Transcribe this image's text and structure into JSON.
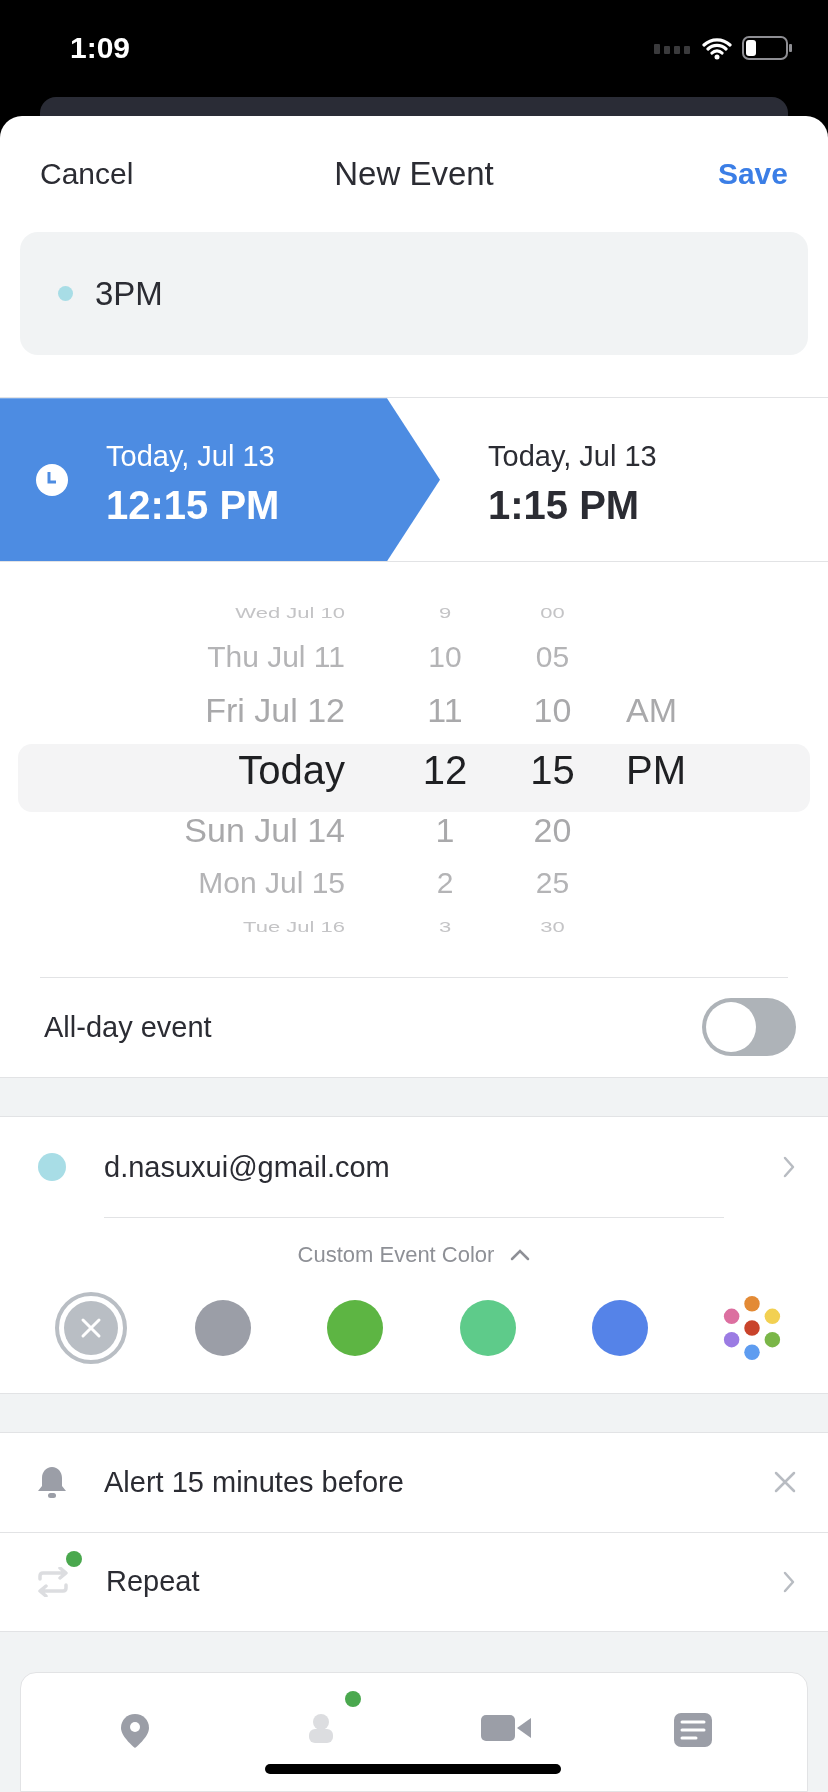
{
  "status_bar": {
    "time": "1:09"
  },
  "header": {
    "cancel": "Cancel",
    "title": "New Event",
    "save": "Save"
  },
  "title_field": {
    "value": "3PM",
    "color": "#a8dde6"
  },
  "time_range": [
    {
      "date": "Today, Jul 13",
      "time": "12:15 PM",
      "selected": true
    },
    {
      "date": "Today, Jul 13",
      "time": "1:15 PM",
      "selected": false
    }
  ],
  "picker": {
    "rows": [
      {
        "day": "Wed Jul 10",
        "hour": "9",
        "minute": "00",
        "period": "",
        "selected": false
      },
      {
        "day": "Thu Jul 11",
        "hour": "10",
        "minute": "05",
        "period": "",
        "selected": false
      },
      {
        "day": "Fri Jul 12",
        "hour": "11",
        "minute": "10",
        "period": "AM",
        "selected": false
      },
      {
        "day": "Today",
        "hour": "12",
        "minute": "15",
        "period": "PM",
        "selected": true
      },
      {
        "day": "Sun Jul 14",
        "hour": "1",
        "minute": "20",
        "period": "",
        "selected": false
      },
      {
        "day": "Mon Jul 15",
        "hour": "2",
        "minute": "25",
        "period": "",
        "selected": false
      },
      {
        "day": "Tue Jul 16",
        "hour": "3",
        "minute": "30",
        "period": "",
        "selected": false
      }
    ]
  },
  "all_day": {
    "label": "All-day event",
    "on": false
  },
  "calendar": {
    "account": "d.nasuxui@gmail.com",
    "color": "#a8dde6",
    "color_heading": "Custom Event Color",
    "expanded": true
  },
  "swatches": [
    {
      "kind": "none",
      "selected": true
    },
    {
      "kind": "color",
      "color": "#9b9ea7",
      "selected": false
    },
    {
      "kind": "color",
      "color": "#5db543",
      "selected": false
    },
    {
      "kind": "color",
      "color": "#5ecb8a",
      "selected": false
    },
    {
      "kind": "color",
      "color": "#5583e8",
      "selected": false
    },
    {
      "kind": "palette",
      "selected": false
    }
  ],
  "alert": {
    "label": "Alert 15 minutes before"
  },
  "repeat": {
    "label": "Repeat",
    "badge": true
  },
  "toolbar": [
    {
      "kind": "location",
      "badge": false
    },
    {
      "kind": "person",
      "badge": true
    },
    {
      "kind": "video",
      "badge": false
    },
    {
      "kind": "notes",
      "badge": false
    }
  ]
}
